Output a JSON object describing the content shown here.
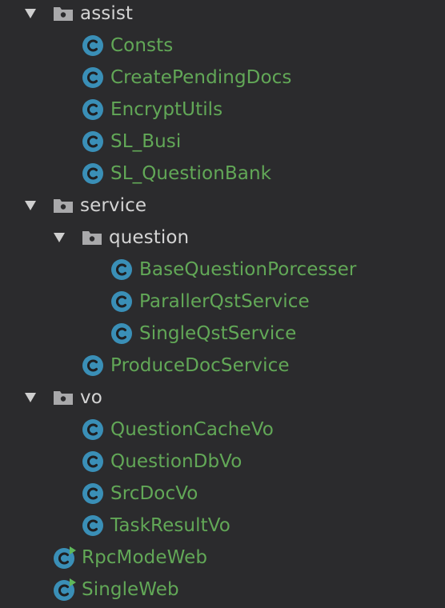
{
  "tree": {
    "assist": {
      "label": "assist",
      "children": [
        "Consts",
        "CreatePendingDocs",
        "EncryptUtils",
        "SL_Busi",
        "SL_QuestionBank"
      ]
    },
    "service": {
      "label": "service",
      "question": {
        "label": "question",
        "children": [
          "BaseQuestionPorcesser",
          "ParallerQstService",
          "SingleQstService"
        ]
      },
      "children": [
        "ProduceDocService"
      ]
    },
    "vo": {
      "label": "vo",
      "children": [
        "QuestionCacheVo",
        "QuestionDbVo",
        "SrcDocVo",
        "TaskResultVo"
      ]
    },
    "root_classes": [
      "RpcModeWeb",
      "SingleWeb"
    ]
  },
  "colors": {
    "background": "#2b2b2d",
    "folder_text": "#d4d4d4",
    "class_text": "#62a857",
    "class_icon": "#3a8fb7",
    "run_marker": "#5fb85a"
  },
  "icons": {
    "expand": "triangle-down-icon",
    "package": "package-folder-icon",
    "class": "class-c-icon",
    "runnable_class": "runnable-class-icon"
  }
}
